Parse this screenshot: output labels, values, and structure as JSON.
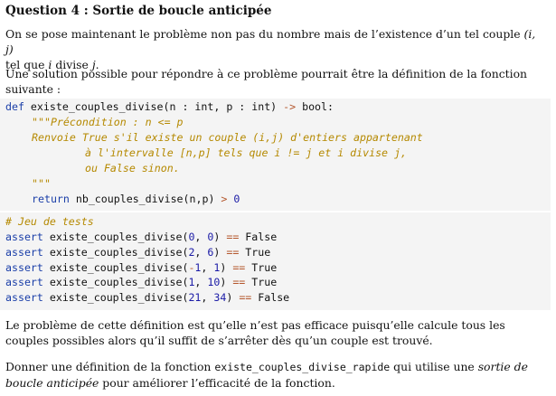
{
  "title": "Question 4 : Sortie de boucle anticipée",
  "para1": {
    "a": "On se pose maintenant le problème non pas du nombre mais de l’existence d’un tel couple ",
    "couple": "(i, j)",
    "b": "tel que ",
    "i": "i",
    "c": " divise ",
    "j": "j",
    "d": "."
  },
  "para2": "Une solution possible pour répondre à ce problème pourrait être la définition de la fonction suivante :",
  "code1": {
    "def_kw": "def",
    "signature": " existe_couples_divise(n : int, p : int) ",
    "arrow": "->",
    "ret_type": " bool:",
    "doc1": "\"\"\"Précondition : n <= p",
    "doc2": "Renvoie True s'il existe un couple (i,j) d'entiers appartenant",
    "doc3": "à l'intervalle [n,p] tels que i != j et i divise j,",
    "doc4": "ou False sinon.",
    "doc5": "\"\"\"",
    "ret_kw": "return",
    "ret_expr": " nb_couples_divise(n,p) ",
    "gt": ">",
    "zero": "0"
  },
  "code2": {
    "comment": "# Jeu de tests",
    "tests": [
      {
        "kw": "assert",
        "call": " existe_couples_divise(",
        "args": [
          {
            "t": "num",
            "v": "0"
          },
          {
            "t": "txt",
            "v": ", "
          },
          {
            "t": "num",
            "v": "0"
          }
        ],
        "close": ") ",
        "eq": "==",
        "res": " False"
      },
      {
        "kw": "assert",
        "call": " existe_couples_divise(",
        "args": [
          {
            "t": "num",
            "v": "2"
          },
          {
            "t": "txt",
            "v": ", "
          },
          {
            "t": "num",
            "v": "6"
          }
        ],
        "close": ") ",
        "eq": "==",
        "res": " True"
      },
      {
        "kw": "assert",
        "call": " existe_couples_divise(",
        "args": [
          {
            "t": "op",
            "v": "-"
          },
          {
            "t": "num",
            "v": "1"
          },
          {
            "t": "txt",
            "v": ", "
          },
          {
            "t": "num",
            "v": "1"
          }
        ],
        "close": ") ",
        "eq": "==",
        "res": " True"
      },
      {
        "kw": "assert",
        "call": " existe_couples_divise(",
        "args": [
          {
            "t": "num",
            "v": "1"
          },
          {
            "t": "txt",
            "v": ", "
          },
          {
            "t": "num",
            "v": "10"
          }
        ],
        "close": ") ",
        "eq": "==",
        "res": " True"
      },
      {
        "kw": "assert",
        "call": " existe_couples_divise(",
        "args": [
          {
            "t": "num",
            "v": "21"
          },
          {
            "t": "txt",
            "v": ", "
          },
          {
            "t": "num",
            "v": "34"
          }
        ],
        "close": ") ",
        "eq": "==",
        "res": " False"
      }
    ]
  },
  "para3": "Le problème de cette définition est qu’elle n’est pas efficace puisqu’elle calcule tous les couples possibles alors qu’il suffit de s’arrêter dès qu’un couple est trouvé.",
  "para4": {
    "a": "Donner une définition de la fonction ",
    "fn": "existe_couples_divise_rapide",
    "b": " qui utilise une ",
    "emph": "sortie de boucle anticipée",
    "c": " pour améliorer l’efficacité de la fonction."
  }
}
